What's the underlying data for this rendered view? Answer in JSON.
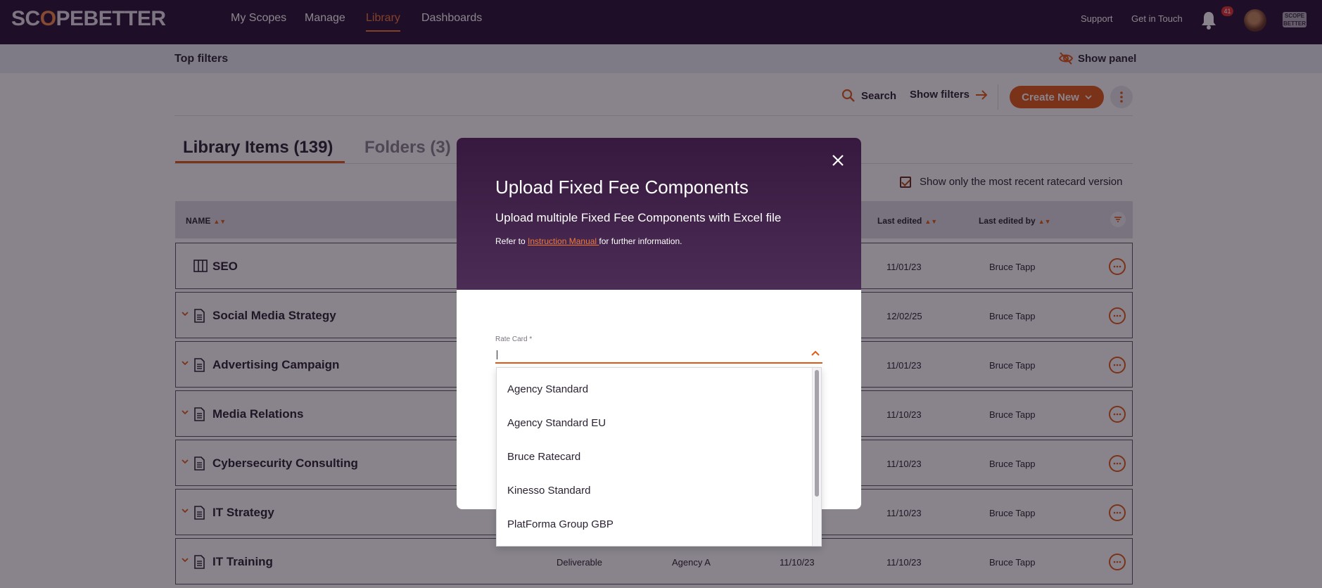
{
  "nav": {
    "logo_a": "SC",
    "logo_o": "O",
    "logo_b": "PEBETTER",
    "links": [
      "My Scopes",
      "Manage",
      "Library",
      "Dashboards"
    ],
    "active_link": "Library",
    "support": "Support",
    "get_in_touch": "Get in Touch",
    "notifications_count": "41",
    "org_logo_text": "SCOPE BETTER"
  },
  "topbar": {
    "title": "Top filters",
    "show_panel": "Show panel"
  },
  "toolbar": {
    "search": "Search",
    "show_filters": "Show filters",
    "create_new": "Create New"
  },
  "tabs": {
    "library_items": "Library Items (139)",
    "folders": "Folders (3)"
  },
  "recent_ratecard": {
    "label": "Show only the most recent ratecard version",
    "checked": true
  },
  "table": {
    "headers": {
      "name": "NAME",
      "last_edited": "Last edited",
      "last_edited_by": "Last edited by"
    },
    "rows": [
      {
        "name": "SEO",
        "type": "",
        "agency": "",
        "created": "",
        "edited": "11/01/23",
        "by": "Bruce Tapp",
        "icon": "columns-icon"
      },
      {
        "name": "Social Media Strategy",
        "type": "",
        "agency": "",
        "created": "",
        "edited": "12/02/25",
        "by": "Bruce Tapp",
        "icon": "document-icon"
      },
      {
        "name": "Advertising Campaign",
        "type": "",
        "agency": "",
        "created": "",
        "edited": "11/01/23",
        "by": "Bruce Tapp",
        "icon": "document-icon"
      },
      {
        "name": "Media Relations",
        "type": "",
        "agency": "",
        "created": "",
        "edited": "11/10/23",
        "by": "Bruce Tapp",
        "icon": "document-icon"
      },
      {
        "name": "Cybersecurity Consulting",
        "type": "",
        "agency": "",
        "created": "",
        "edited": "11/10/23",
        "by": "Bruce Tapp",
        "icon": "document-icon"
      },
      {
        "name": "IT Strategy",
        "type": "",
        "agency": "",
        "created": "",
        "edited": "11/10/23",
        "by": "Bruce Tapp",
        "icon": "document-icon"
      },
      {
        "name": "IT Training",
        "type": "Deliverable",
        "agency": "Agency A",
        "created": "11/10/23",
        "edited": "11/10/23",
        "by": "Bruce Tapp",
        "icon": "document-icon"
      }
    ]
  },
  "modal": {
    "title": "Upload Fixed Fee Components",
    "subtitle": "Upload multiple Fixed Fee Components with Excel file",
    "ref_prefix": "Refer to ",
    "ref_link": "Instruction Manual ",
    "ref_suffix": "for further information.",
    "rate_card_label": "Rate Card *",
    "rate_card_value": ""
  },
  "dropdown": {
    "options": [
      "Agency Standard",
      "Agency Standard EU",
      "Bruce Ratecard",
      "Kinesso Standard",
      "PlatForma Group GBP"
    ]
  },
  "colors": {
    "nav_bg": "#2a1336",
    "accent": "#e05a17",
    "modal_header": "#37193f"
  }
}
